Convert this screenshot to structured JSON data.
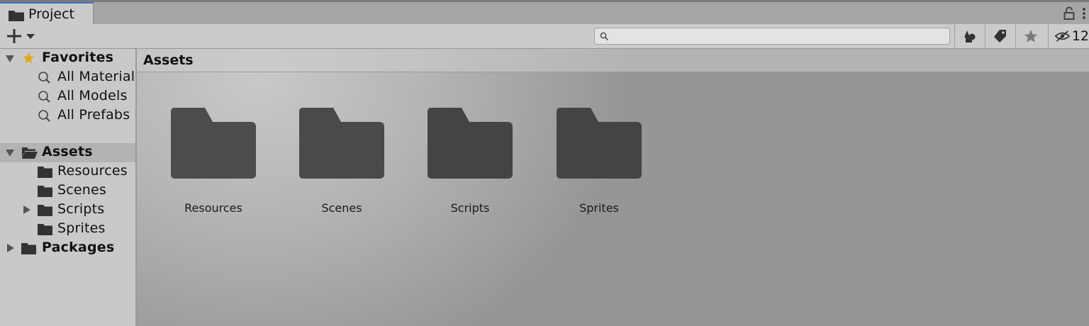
{
  "window": {
    "tab_label": "Project",
    "tab_icon": "folder-icon",
    "actions": [
      "lock-icon",
      "kebab-menu-icon"
    ]
  },
  "toolbar": {
    "create_label": "+",
    "create_icons": [
      "plus-icon",
      "dropdown-arrow-icon"
    ],
    "search": {
      "value": "",
      "placeholder": ""
    },
    "buttons": [
      "filter-by-type-icon",
      "filter-by-label-icon",
      "favorite-star-icon"
    ],
    "hidden_packages_count": "12",
    "colors": {
      "icon": "#3c3c3c",
      "accent": "#3f74c7"
    }
  },
  "sidebar": {
    "favorites": {
      "label": "Favorites",
      "icon": "star-icon",
      "star_color": "#e3a81e",
      "items": [
        {
          "label": "All Material",
          "icon": "search-icon"
        },
        {
          "label": "All Models",
          "icon": "search-icon"
        },
        {
          "label": "All Prefabs",
          "icon": "search-icon"
        }
      ]
    },
    "assets": {
      "label": "Assets",
      "icon": "open-folder-icon",
      "selected": true,
      "children": [
        {
          "label": "Resources",
          "icon": "folder-icon",
          "expandable": false
        },
        {
          "label": "Scenes",
          "icon": "folder-icon",
          "expandable": false
        },
        {
          "label": "Scripts",
          "icon": "folder-icon",
          "expandable": true
        },
        {
          "label": "Sprites",
          "icon": "folder-icon",
          "expandable": false
        }
      ]
    },
    "packages": {
      "label": "Packages",
      "icon": "folder-icon"
    }
  },
  "content": {
    "breadcrumb": "Assets",
    "items": [
      {
        "label": "Resources",
        "icon": "folder-icon"
      },
      {
        "label": "Scenes",
        "icon": "folder-icon"
      },
      {
        "label": "Scripts",
        "icon": "folder-icon"
      },
      {
        "label": "Sprites",
        "icon": "folder-icon"
      }
    ],
    "folder_color": "#4c4c4c"
  }
}
